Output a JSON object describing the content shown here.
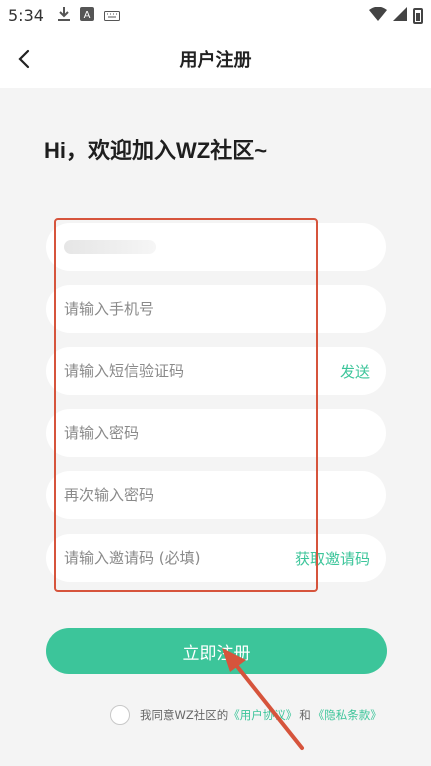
{
  "status_bar": {
    "time": "5:34",
    "icons": [
      "download-icon",
      "a-badge-icon",
      "keyboard-icon",
      "wifi-icon",
      "signal-icon",
      "battery-icon"
    ]
  },
  "nav": {
    "title": "用户注册",
    "back_icon": "chevron-left-icon"
  },
  "welcome_text": "Hi，欢迎加入WZ社区~",
  "form": {
    "username_value": "",
    "phone_placeholder": "请输入手机号",
    "sms_placeholder": "请输入短信验证码",
    "sms_send_label": "发送",
    "password_placeholder": "请输入密码",
    "confirm_password_placeholder": "再次输入密码",
    "invite_placeholder": "请输入邀请码 (必填)",
    "invite_get_label": "获取邀请码"
  },
  "register_button_label": "立即注册",
  "agreement": {
    "prefix": "我同意WZ社区的",
    "user_agreement": "《用户协议》",
    "and": "和",
    "privacy": "《隐私条款》"
  },
  "colors": {
    "accent": "#3cc59a",
    "highlight": "#d6543c",
    "background": "#f4f4f4"
  }
}
